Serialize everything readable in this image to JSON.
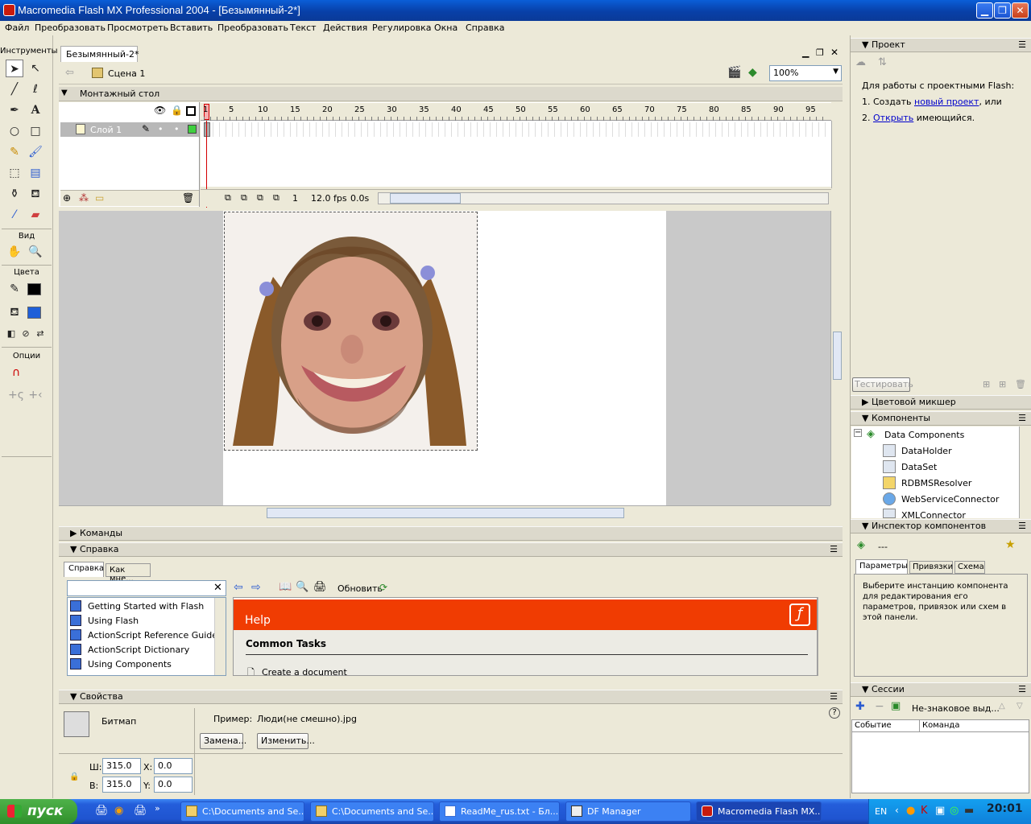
{
  "window": {
    "title": "Macromedia Flash MX Professional 2004 - [Безымянный-2*]"
  },
  "menu": [
    "Файл",
    "Преобразовать",
    "Просмотреть",
    "Вставить",
    "Преобразовать",
    "Текст",
    "Действия",
    "Регулировка",
    "Окна",
    "Справка"
  ],
  "tools": {
    "header": "Инструменты",
    "view_label": "Вид",
    "colors_label": "Цвета",
    "options_label": "Опции"
  },
  "document": {
    "tab": "Безымянный-2*",
    "scene": "Сцена 1",
    "zoom": "100%"
  },
  "timeline": {
    "header": "Монтажный стол",
    "layer": "Слой 1",
    "ruler": [
      "1",
      "5",
      "10",
      "15",
      "20",
      "25",
      "30",
      "35",
      "40",
      "45",
      "50",
      "55",
      "60",
      "65",
      "70",
      "75",
      "80",
      "85",
      "90",
      "95"
    ],
    "frame": "1",
    "fps": "12.0 fps",
    "time": "0.0s"
  },
  "panels": {
    "commands": "Команды",
    "help": "Справка",
    "help_tab1": "Справка",
    "help_tab2": "Как мне...",
    "help_refresh": "Обновить",
    "help_items": [
      "Getting Started with Flash",
      "Using Flash",
      "ActionScript Reference Guide",
      "ActionScript Dictionary",
      "Using Components"
    ],
    "help_title": "Help",
    "help_common": "Common Tasks",
    "help_create": "Create a document",
    "properties": "Свойства"
  },
  "properties": {
    "type": "Битмап",
    "instance_label": "Пример:",
    "instance_value": "Люди(не смешно).jpg",
    "swap_btn": "Замена...",
    "edit_btn": "Изменить...",
    "w_label": "Ш:",
    "w_value": "315.0",
    "h_label": "В:",
    "h_value": "315.0",
    "x_label": "X:",
    "x_value": "0.0",
    "y_label": "Y:",
    "y_value": "0.0"
  },
  "project": {
    "header": "Проект",
    "intro": "Для работы с проектными Flash:",
    "step1_prefix": "1. Создать ",
    "step1_link": "новый проект",
    "step1_suffix": ", или",
    "step2_prefix": "2. ",
    "step2_link": "Открыть",
    "step2_suffix": " имеющийся.",
    "test_btn": "Тестировать"
  },
  "color_mixer": "Цветовой микшер",
  "components": {
    "header": "Компоненты",
    "group": "Data Components",
    "items": [
      "DataHolder",
      "DataSet",
      "RDBMSResolver",
      "WebServiceConnector",
      "XMLConnector"
    ]
  },
  "component_inspector": {
    "header": "Инспектор компонентов",
    "value": "---",
    "tabs": [
      "Параметры",
      "Привязки",
      "Схема"
    ],
    "message": "Выберите инстанцию компонента для редактирования его параметров, привязок или схем в этой панели."
  },
  "sessions": {
    "header": "Сессии",
    "dropdown": "Не-знаковое выд...",
    "col1": "Событие",
    "col2": "Команда"
  },
  "taskbar": {
    "start": "пуск",
    "tasks": [
      "C:\\Documents and Se...",
      "C:\\Documents and Se...",
      "ReadMe_rus.txt - Бл...",
      "DF Manager",
      "Macromedia Flash MX..."
    ],
    "lang": "EN"
  },
  "colors": {
    "accent_orange": "#f03c02",
    "titlebar_blue": "#0a5ed8",
    "playhead_red": "#d40000"
  }
}
